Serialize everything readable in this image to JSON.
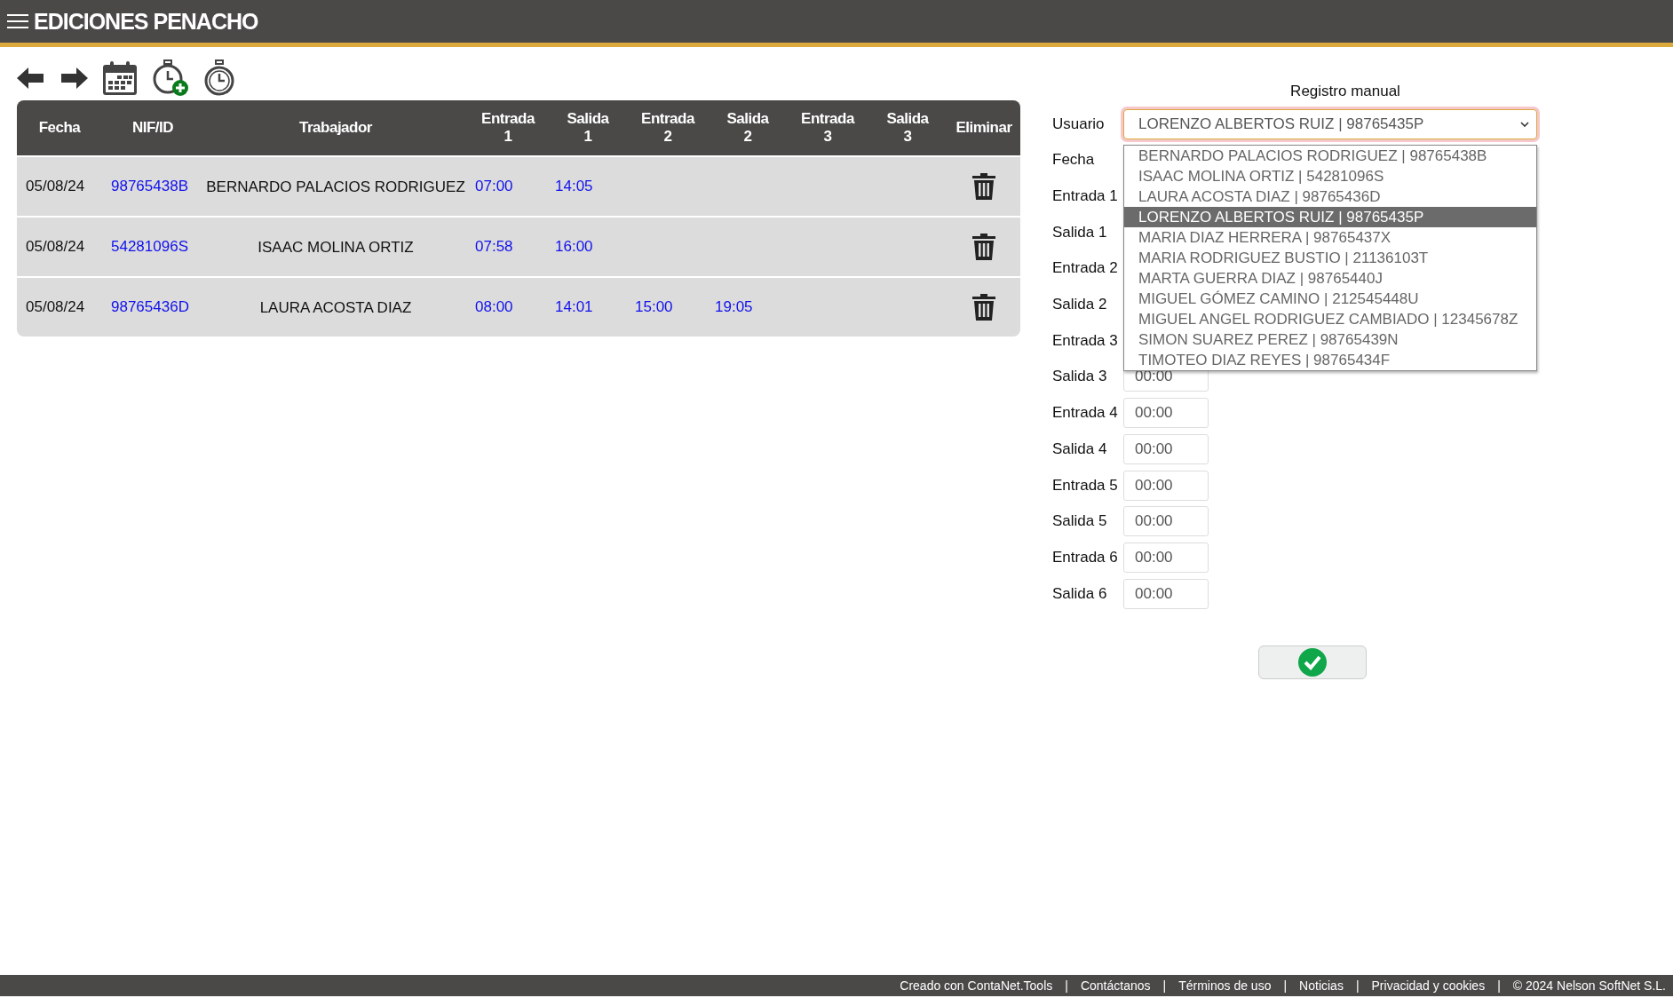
{
  "app_bar": {
    "title": "EDICIONES PENACHO"
  },
  "table": {
    "columns": [
      "Fecha",
      "NIF/ID",
      "Trabajador",
      "Entrada\n1",
      "Salida\n1",
      "Entrada\n2",
      "Salida\n2",
      "Entrada\n3",
      "Salida\n3",
      "Eliminar"
    ],
    "rows": [
      {
        "fecha": "05/08/24",
        "nif": "98765438B",
        "trabajador": "BERNARDO PALACIOS RODRIGUEZ",
        "times": [
          "07:00",
          "14:05"
        ]
      },
      {
        "fecha": "05/08/24",
        "nif": "54281096S",
        "trabajador": "ISAAC MOLINA ORTIZ",
        "times": [
          "07:58",
          "16:00"
        ]
      },
      {
        "fecha": "05/08/24",
        "nif": "98765436D",
        "trabajador": "LAURA ACOSTA DIAZ",
        "times": [
          "08:00",
          "14:01",
          "15:00",
          "19:05"
        ]
      }
    ]
  },
  "form": {
    "title": "Registro manual",
    "usuario_label": "Usuario",
    "usuario_value": "LORENZO ALBERTOS RUIZ | 98765435P",
    "options": [
      {
        "label": "BERNARDO PALACIOS RODRIGUEZ | 98765438B",
        "selected": false
      },
      {
        "label": "ISAAC MOLINA ORTIZ | 54281096S",
        "selected": false
      },
      {
        "label": "LAURA ACOSTA DIAZ | 98765436D",
        "selected": false
      },
      {
        "label": "LORENZO ALBERTOS RUIZ | 98765435P",
        "selected": true
      },
      {
        "label": "MARIA DIAZ HERRERA | 98765437X",
        "selected": false
      },
      {
        "label": "MARIA RODRIGUEZ BUSTIO | 21136103T",
        "selected": false
      },
      {
        "label": "MARTA GUERRA DIAZ | 98765440J",
        "selected": false
      },
      {
        "label": "MIGUEL GÓMEZ CAMINO | 212545448U",
        "selected": false
      },
      {
        "label": "MIGUEL ANGEL RODRIGUEZ CAMBIADO | 12345678Z",
        "selected": false
      },
      {
        "label": "SIMON SUAREZ PEREZ | 98765439N",
        "selected": false
      },
      {
        "label": "TIMOTEO DIAZ REYES | 98765434F",
        "selected": false
      }
    ],
    "fields": [
      {
        "label": "Fecha"
      },
      {
        "label": "Entrada 1"
      },
      {
        "label": "Salida 1"
      },
      {
        "label": "Entrada 2"
      },
      {
        "label": "Salida 2"
      },
      {
        "label": "Entrada 3"
      },
      {
        "label": "Salida 3",
        "value": "00:00"
      },
      {
        "label": "Entrada 4",
        "value": "00:00"
      },
      {
        "label": "Salida 4",
        "value": "00:00"
      },
      {
        "label": "Entrada 5",
        "value": "00:00"
      },
      {
        "label": "Salida 5",
        "value": "00:00"
      },
      {
        "label": "Entrada 6",
        "value": "00:00"
      },
      {
        "label": "Salida 6",
        "value": "00:00"
      }
    ]
  },
  "footer": {
    "links": [
      "Creado con ContaNet.Tools",
      "Contáctanos",
      "Términos de uso",
      "Noticias",
      "Privacidad y cookies"
    ],
    "separator": "|",
    "copyright": "© 2024 Nelson SoftNet S.L."
  }
}
